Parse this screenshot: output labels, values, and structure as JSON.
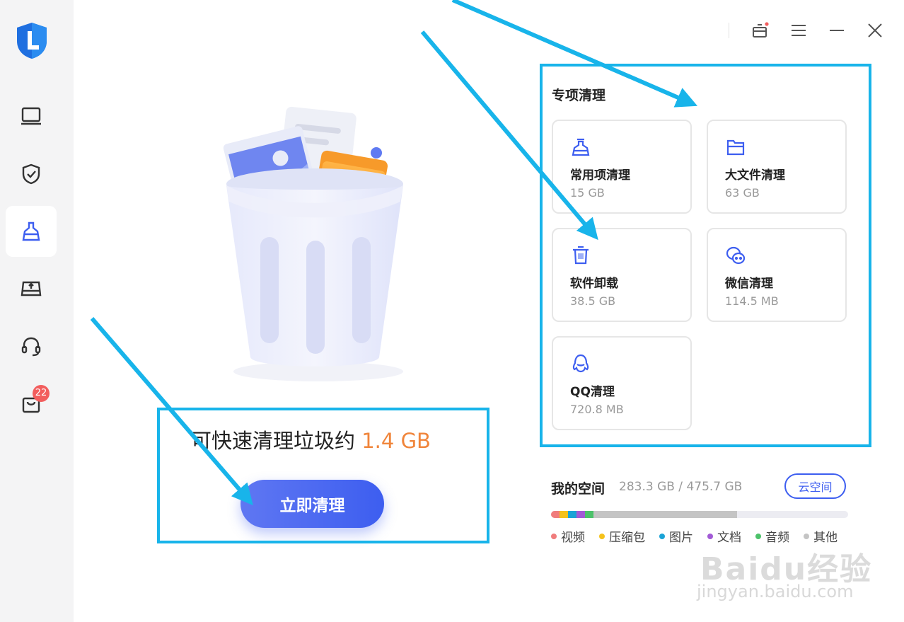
{
  "sidebar": {
    "items": [
      {
        "name": "screen-icon",
        "active": false
      },
      {
        "name": "shield-check-icon",
        "active": false
      },
      {
        "name": "broom-icon",
        "active": true
      },
      {
        "name": "drive-upload-icon",
        "active": false
      },
      {
        "name": "headset-icon",
        "active": false
      },
      {
        "name": "shopping-bag-icon",
        "active": false,
        "badge": "22"
      }
    ]
  },
  "window_controls": [
    "gift-box-icon",
    "menu-icon",
    "minimize-icon",
    "close-icon"
  ],
  "summary": {
    "prefix": "可快速清理垃圾约",
    "size": "1.4 GB",
    "clean_button": "立即清理"
  },
  "special": {
    "title": "专项清理",
    "cards": [
      {
        "icon": "broom-icon",
        "name": "常用项清理",
        "size": "15 GB"
      },
      {
        "icon": "folder-icon",
        "name": "大文件清理",
        "size": "63 GB"
      },
      {
        "icon": "trash-icon",
        "name": "软件卸载",
        "size": "38.5 GB"
      },
      {
        "icon": "wechat-icon",
        "name": "微信清理",
        "size": "114.5 MB"
      },
      {
        "icon": "qq-penguin-icon",
        "name": "QQ清理",
        "size": "720.8 MB"
      }
    ]
  },
  "space": {
    "title": "我的空间",
    "value": "283.3 GB / 475.7 GB",
    "cloud_button": "云空间",
    "legend": [
      {
        "label": "视频",
        "color": "#f07c7c"
      },
      {
        "label": "压缩包",
        "color": "#f5c21b"
      },
      {
        "label": "图片",
        "color": "#1aa3d6"
      },
      {
        "label": "文档",
        "color": "#a25ad6"
      },
      {
        "label": "音频",
        "color": "#4cc26a"
      },
      {
        "label": "其他",
        "color": "#c4c4c4"
      }
    ]
  },
  "watermark": {
    "brand": "Baidu经验",
    "url": "jingyan.baidu.com"
  },
  "colors": {
    "accent": "#3d5ef0",
    "highlight": "#f0853b",
    "annotation": "#18b4ea"
  }
}
